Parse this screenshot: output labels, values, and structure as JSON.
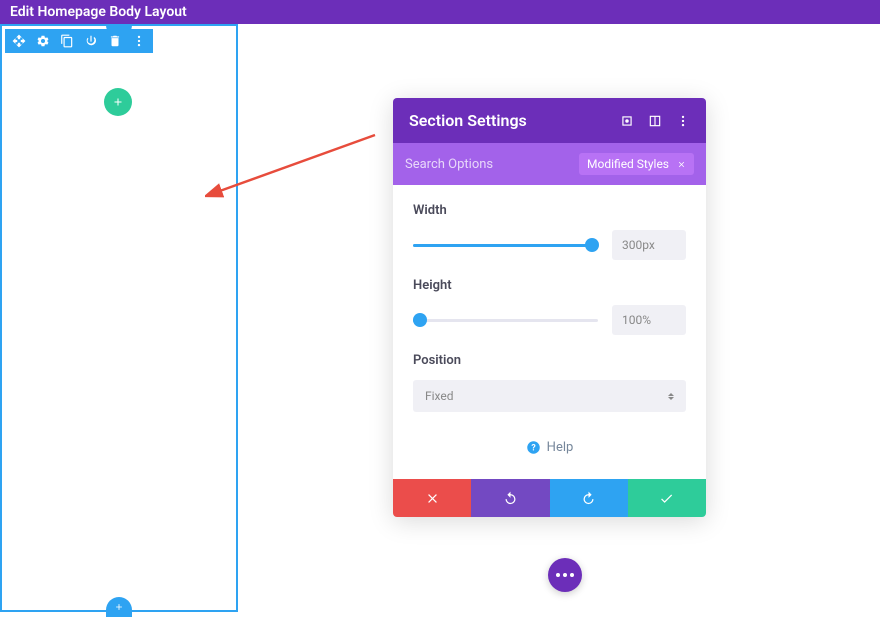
{
  "topbar": {
    "title": "Edit Homepage Body Layout"
  },
  "panel": {
    "title": "Section Settings",
    "search_placeholder": "Search Options",
    "modified_label": "Modified Styles",
    "controls": {
      "width": {
        "label": "Width",
        "value": "300px",
        "fill_pct": 97
      },
      "height": {
        "label": "Height",
        "value": "100%",
        "fill_pct": 4
      },
      "position": {
        "label": "Position",
        "value": "Fixed"
      }
    },
    "help_label": "Help"
  },
  "colors": {
    "purple": "#6c2eb9",
    "light_purple": "#a362ea",
    "pill_purple": "#b872f5",
    "blue": "#2ea3f2",
    "green": "#2ecc9a",
    "red": "#eb4d4b",
    "footer_purple": "#7349c2"
  }
}
